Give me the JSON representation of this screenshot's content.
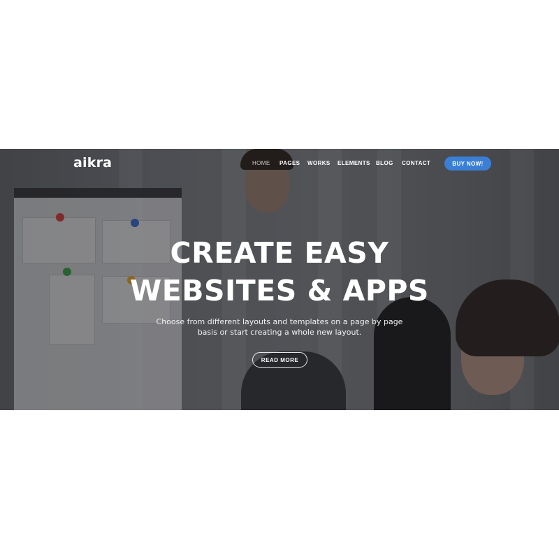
{
  "header": {
    "logo": "aikra",
    "nav": [
      "HOME",
      "PAGES",
      "WORKS",
      "ELEMENTS",
      "BLOG",
      "CONTACT"
    ],
    "active_nav": "HOME",
    "buy_label": "BUY NOW!"
  },
  "hero": {
    "headline_line1": "CREATE EASY",
    "headline_line2": "WEBSITES & APPS",
    "subtitle_line1": "Choose from different layouts and templates on a page by page",
    "subtitle_line2": "basis or start creating a whole new layout.",
    "cta_label": "READ MORE"
  },
  "colors": {
    "accent": "#3a7fd5",
    "text": "#ffffff",
    "overlay": "#141619"
  },
  "icons": {
    "board_pins": [
      "red-pin",
      "blue-pin",
      "green-pin",
      "orange-pin"
    ]
  }
}
